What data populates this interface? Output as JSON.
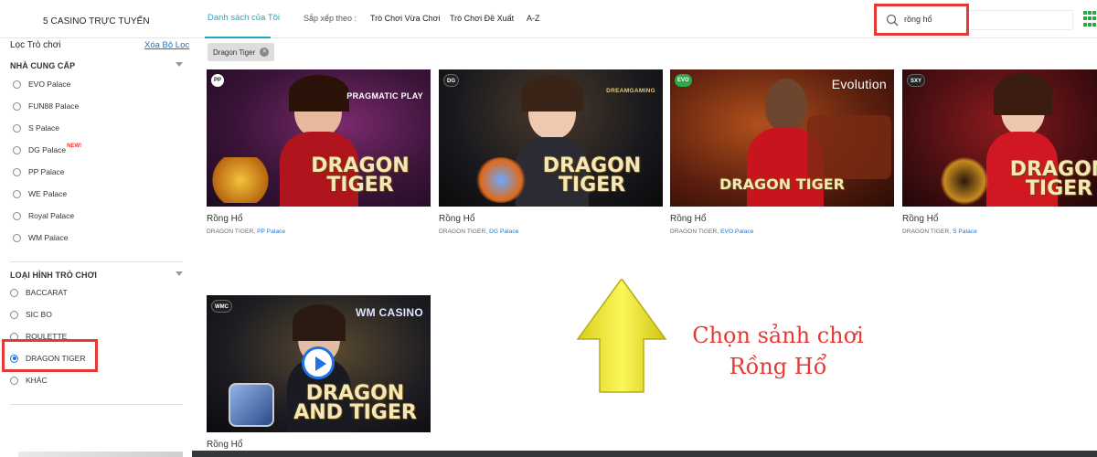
{
  "header": {
    "brand": "5  CASINO TRỰC TUYẾN",
    "tab_mine": "Danh sách của Tôi",
    "sort_label": "Sắp xếp theo :",
    "sort_options": [
      "Trò Chơi Vừa Chơi",
      "Trò Chơi Đề Xuất",
      "A-Z"
    ],
    "search_value": "rồng hổ"
  },
  "sidebar": {
    "filter_title": "Lọc Trò chơi",
    "clear_label": "Xóa Bộ Lọc",
    "providers_head": "NHÀ CUNG CẤP",
    "providers": [
      "EVO Palace",
      "FUN88 Palace",
      "S Palace",
      "DG Palace",
      "PP Palace",
      "WE Palace",
      "Royal Palace",
      "WM Palace"
    ],
    "new_badge": "NEW!",
    "types_head": "LOẠI HÌNH TRÒ CHƠI",
    "types": [
      "BACCARAT",
      "SIC BO",
      "ROULETTE",
      "DRAGON TIGER",
      "KHÁC"
    ],
    "selected_type": "DRAGON TIGER"
  },
  "active_filter": {
    "chip": "Dragon Tiger"
  },
  "games": [
    {
      "name": "Rồng Hổ",
      "category": "DRAGON TIGER,",
      "provider": "PP Palace",
      "badge": "PP",
      "logo": "PRAGMATIC PLAY",
      "title_lines": [
        "DRAGON",
        "TIGER"
      ],
      "bg": "#3a1438"
    },
    {
      "name": "Rồng Hổ",
      "category": "DRAGON TIGER,",
      "provider": "DG Palace",
      "badge": "DG",
      "logo": "DREAMGAMING",
      "title_lines": [
        "DRAGON",
        "TIGER"
      ],
      "bg": "#1a1a1e"
    },
    {
      "name": "Rồng Hổ",
      "category": "DRAGON TIGER,",
      "provider": "EVO Palace",
      "badge": "EVO",
      "logo": "Evolution",
      "title_lines": [
        "DRAGON TIGER"
      ],
      "bg": "#5a1e0e"
    },
    {
      "name": "Rồng Hổ",
      "category": "DRAGON TIGER,",
      "provider": "S Palace",
      "badge": "SXY",
      "logo": "",
      "title_lines": [
        "DRAGON",
        "TIGER"
      ],
      "bg": "#4a0f12"
    },
    {
      "name": "Rồng Hổ",
      "category": "",
      "provider": "",
      "badge": "WMC",
      "logo": "WM CASINO",
      "title_lines": [
        "DRAGON",
        "AND TIGER"
      ],
      "bg": "#1c1c22"
    }
  ],
  "annotation": {
    "line1": "Chọn sảnh chơi",
    "line2": "Rồng Hổ"
  },
  "colors": {
    "accent": "#1aa8c4",
    "highlight": "#e53935",
    "arrow": "#f5f04a"
  }
}
